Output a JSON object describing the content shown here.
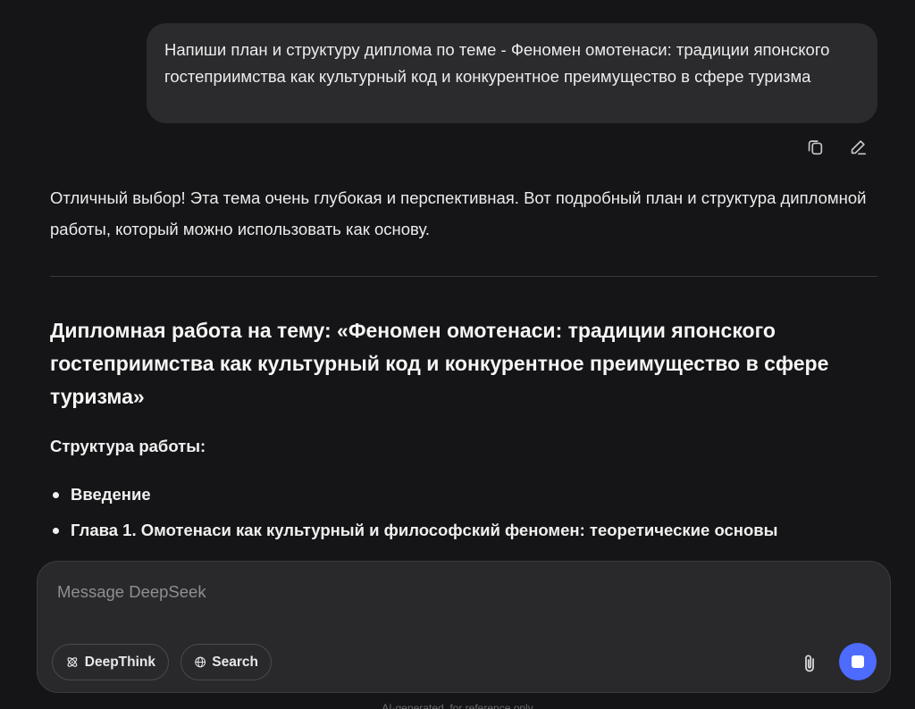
{
  "user_message": {
    "text": "Напиши план и структуру диплома по теме - Феномен омотенаси: традиции японского гостеприимства как культурный код и конкурентное преимущество в сфере туризма"
  },
  "message_actions": {
    "copy_icon": "copy-icon",
    "edit_icon": "edit-icon"
  },
  "assistant_reply": {
    "intro": "Отличный выбор! Эта тема очень глубокая и перспективная. Вот подробный план и структура дипломной работы, который можно использовать как основу.",
    "heading": "Дипломная работа на тему: «Феномен омотенаси: традиции японского гостеприимства как культурный код и конкурентное преимущество в сфере туризма»",
    "structure_label": "Структура работы:",
    "bullets": [
      "Введение",
      "Глава 1. Омотенаси как культурный и философский феномен: теоретические основы"
    ]
  },
  "composer": {
    "placeholder": "Message DeepSeek",
    "value": "",
    "deepthink_label": "DeepThink",
    "search_label": "Search",
    "attach_icon": "paperclip-icon",
    "send_icon": "stop-icon",
    "accent_color": "#4d6bfe"
  },
  "footer": {
    "note": "AI-generated, for reference only"
  }
}
